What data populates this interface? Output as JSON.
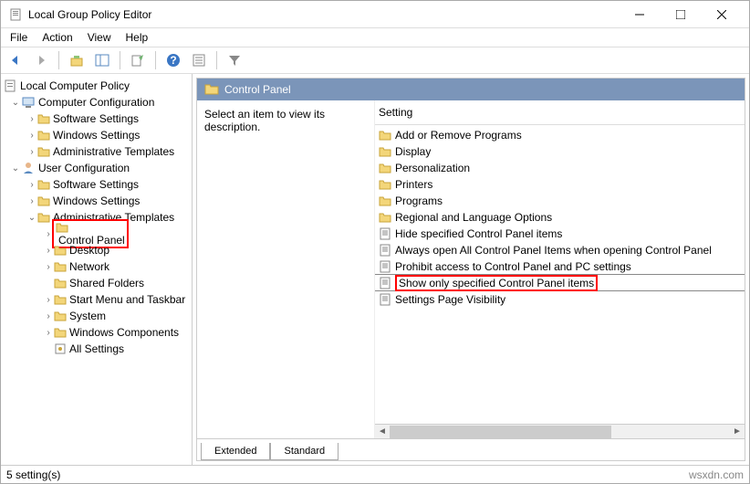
{
  "window": {
    "title": "Local Group Policy Editor"
  },
  "menus": {
    "file": "File",
    "action": "Action",
    "view": "View",
    "help": "Help"
  },
  "tree": {
    "root": "Local Computer Policy",
    "cc": "Computer Configuration",
    "cc_sw": "Software Settings",
    "cc_win": "Windows Settings",
    "cc_at": "Administrative Templates",
    "uc": "User Configuration",
    "uc_sw": "Software Settings",
    "uc_win": "Windows Settings",
    "uc_at": "Administrative Templates",
    "cp": "Control Panel",
    "desktop": "Desktop",
    "network": "Network",
    "shared": "Shared Folders",
    "start": "Start Menu and Taskbar",
    "system": "System",
    "wincomp": "Windows Components",
    "allset": "All Settings"
  },
  "right": {
    "header": "Control Panel",
    "desc": "Select an item to view its description.",
    "col": "Setting",
    "items": [
      {
        "type": "folder",
        "label": "Add or Remove Programs"
      },
      {
        "type": "folder",
        "label": "Display"
      },
      {
        "type": "folder",
        "label": "Personalization"
      },
      {
        "type": "folder",
        "label": "Printers"
      },
      {
        "type": "folder",
        "label": "Programs"
      },
      {
        "type": "folder",
        "label": "Regional and Language Options"
      },
      {
        "type": "policy",
        "label": "Hide specified Control Panel items"
      },
      {
        "type": "policy",
        "label": "Always open All Control Panel Items when opening Control Panel"
      },
      {
        "type": "policy",
        "label": "Prohibit access to Control Panel and PC settings",
        "divider": true
      },
      {
        "type": "policy",
        "label": "Show only specified Control Panel items",
        "highlight": true,
        "divider": true
      },
      {
        "type": "policy",
        "label": "Settings Page Visibility"
      }
    ]
  },
  "tabs": {
    "extended": "Extended",
    "standard": "Standard"
  },
  "status": {
    "text": "5 setting(s)",
    "watermark": "wsxdn.com"
  }
}
